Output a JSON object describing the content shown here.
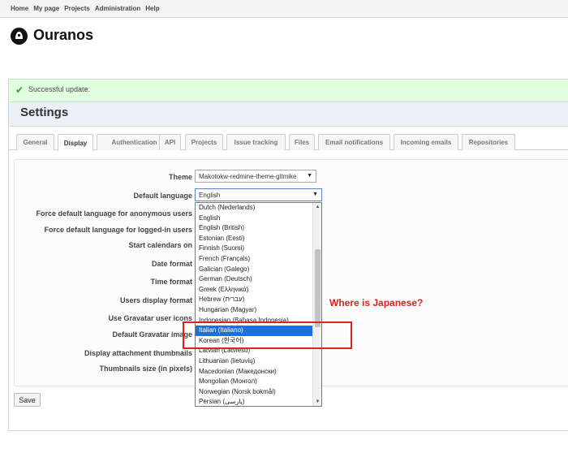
{
  "top_menu": [
    "Home",
    "My page",
    "Projects",
    "Administration",
    "Help"
  ],
  "site": {
    "title": "Ouranos"
  },
  "flash": {
    "message": "Successful update."
  },
  "page": {
    "title": "Settings"
  },
  "tabs": [
    {
      "label": "General",
      "selected": false
    },
    {
      "label": "Display",
      "selected": true
    },
    {
      "label": "Authentication",
      "selected": false
    },
    {
      "label": "API",
      "selected": false
    },
    {
      "label": "Projects",
      "selected": false
    },
    {
      "label": "Issue tracking",
      "selected": false
    },
    {
      "label": "Files",
      "selected": false
    },
    {
      "label": "Email notifications",
      "selected": false
    },
    {
      "label": "Incoming emails",
      "selected": false
    },
    {
      "label": "Repositories",
      "selected": false
    }
  ],
  "form": {
    "labels": [
      "Theme",
      "Default language",
      "Force default language for anonymous users",
      "Force default language for logged-in users",
      "Start calendars on",
      "Date format",
      "Time format",
      "Users display format",
      "Use Gravatar user icons",
      "Default Gravatar image",
      "Display attachment thumbnails",
      "Thumbnails size (in pixels)"
    ],
    "theme_value": "Makotokw-redmine-theme-gitmike",
    "language_value": "English",
    "save_label": "Save"
  },
  "language_dropdown": {
    "options": [
      "Dutch (Nederlands)",
      "English",
      "English (British)",
      "Estonian (Eesti)",
      "Finnish (Suomi)",
      "French (Français)",
      "Galician (Galego)",
      "German (Deutsch)",
      "Greek (Ελληνικά)",
      "Hebrew (עברית)",
      "Hungarian (Magyar)",
      "Indonesian (Bahasa Indonesia)",
      "Italian (Italiano)",
      "Korean (한국어)",
      "Latvian (Latviešu)",
      "Lithuanian (lietuvių)",
      "Macedonian (Македонски)",
      "Mongolian (Монгол)",
      "Norwegian (Norsk bokmål)",
      "Persian (پارسی)"
    ],
    "highlighted": "Italian (Italiano)"
  },
  "annotation": {
    "text": "Where is Japanese?",
    "color": "#e0201f"
  },
  "colors": {
    "flash_bg": "#dfffdf",
    "title_band": "#e9f1f7",
    "highlight": "#1e6fdc"
  },
  "icons": {
    "flash": "check-icon",
    "logo": "site-logo-icon",
    "dropdown_arrow": "chevron-down-icon"
  }
}
